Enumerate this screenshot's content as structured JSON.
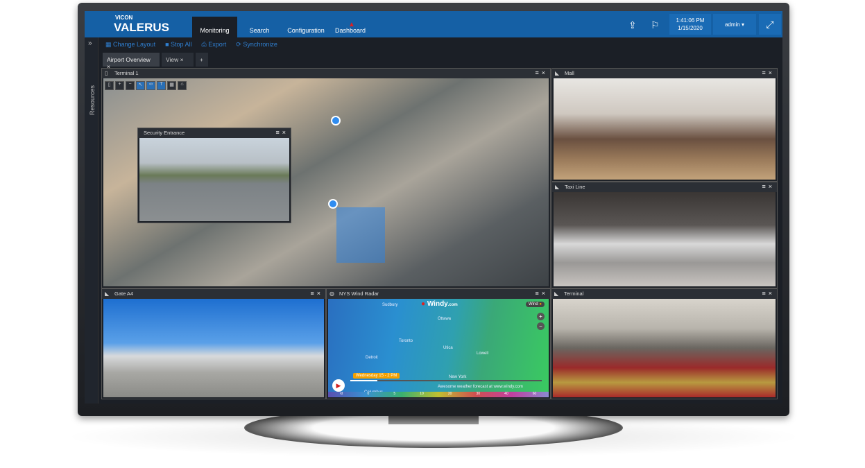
{
  "brand": {
    "company": "VICON",
    "product": "VALERUS"
  },
  "nav": [
    {
      "label": "Monitoring",
      "active": true
    },
    {
      "label": "Search"
    },
    {
      "label": "Configuration"
    },
    {
      "label": "Dashboard",
      "alert": true
    }
  ],
  "header": {
    "time": "1:41:06 PM",
    "date": "1/15/2020",
    "user": "admin"
  },
  "toolbar": {
    "change_layout": "Change Layout",
    "stop_all": "Stop All",
    "export": "Export",
    "synchronize": "Synchronize"
  },
  "sidebar": {
    "label": "Resources"
  },
  "tabs": [
    {
      "label": "Airport Overview",
      "active": true
    },
    {
      "label": "View"
    }
  ],
  "add_tab": "+",
  "panels": {
    "terminal1": "Terminal 1",
    "security": "Security Entrance",
    "mall": "Mall",
    "taxi": "Taxi Line",
    "gate": "Gate A4",
    "radar": "NYS Wind Radar",
    "terminal": "Terminal"
  },
  "radar": {
    "brand": "Windy",
    "brand_suffix": ".com",
    "layer": "Wind",
    "time": "Wednesday 15 - 2 PM",
    "footer": "Awesome weather forecast at www.windy.com",
    "cities": [
      "Sudbury",
      "Ottawa",
      "Toronto",
      "Utica",
      "Lowell",
      "Detroit",
      "New York",
      "Columbus"
    ],
    "scale": [
      "kt",
      "0",
      "5",
      "10",
      "20",
      "30",
      "40",
      "60"
    ]
  },
  "colors": {
    "header": "#1560a5",
    "accent": "#2f7fd0",
    "alert": "#e02020"
  }
}
